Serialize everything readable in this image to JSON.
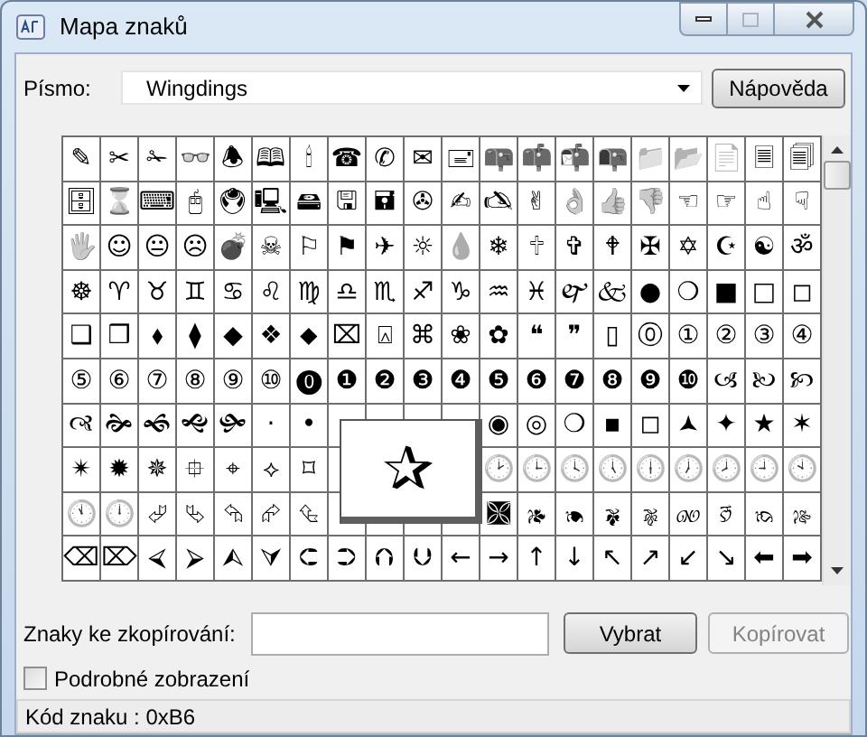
{
  "window": {
    "title": "Mapa znaků"
  },
  "font_label": "Písmo:",
  "font": {
    "value": "Wingdings"
  },
  "help_button": "Nápověda",
  "grid": {
    "rows": [
      [
        "✎",
        "✂",
        "✁",
        "👓",
        "🕭",
        "🕮",
        "🕯",
        "☎",
        "✆",
        "✉",
        "🖃",
        "📪",
        "📫",
        "📬",
        "📭",
        "📁",
        "📂",
        "📄",
        "🗏",
        "🗐"
      ],
      [
        "🗄",
        "⌛",
        "⌨",
        "🖰",
        "🖲",
        "🖳",
        "🖴",
        "🖫",
        "🖬",
        "✇",
        "✍",
        "🖎",
        "✌",
        "👌",
        "👍",
        "👎",
        "☜",
        "☞",
        "☝",
        "☟"
      ],
      [
        "🖐",
        "☺",
        "😐",
        "☹",
        "💣",
        "☠",
        "⚐",
        "⚑",
        "✈",
        "☼",
        "💧",
        "❄",
        "🕆",
        "✞",
        "🕈",
        "✠",
        "✡",
        "☪",
        "☯",
        "ॐ"
      ],
      [
        "☸",
        "♈",
        "♉",
        "♊",
        "♋",
        "♌",
        "♍",
        "♎",
        "♏",
        "♐",
        "♑",
        "♒",
        "♓",
        "🙰",
        "🙵",
        "●",
        "❍",
        "■",
        "□",
        "◻"
      ],
      [
        "❑",
        "❒",
        "⬧",
        "⧫",
        "◆",
        "❖",
        "⬥",
        "⌧",
        "⍓",
        "⌘",
        "❀",
        "✿",
        "❝",
        "❞",
        "▯",
        "⓪",
        "①",
        "②",
        "③",
        "④"
      ],
      [
        "⑤",
        "⑥",
        "⑦",
        "⑧",
        "⑨",
        "⑩",
        "⓿",
        "❶",
        "❷",
        "❸",
        "❹",
        "❺",
        "❻",
        "❼",
        "❽",
        "❾",
        "❿",
        "🙢",
        "🙠",
        "🙡"
      ],
      [
        "🙣",
        "🙞",
        "🙜",
        "🙝",
        "🙟",
        "·",
        "•",
        null,
        null,
        null,
        null,
        "◉",
        "◎",
        "❍",
        "▪",
        "◻",
        "🟂",
        "✦",
        "★",
        "✶"
      ],
      [
        "✴",
        "✹",
        "✵",
        "⯐",
        "⌖",
        "⟡",
        "⌑",
        null,
        null,
        null,
        null,
        "🕑",
        "🕒",
        "🕓",
        "🕔",
        "🕕",
        "🕖",
        "🕗",
        "🕘",
        "🕙"
      ],
      [
        "🕚",
        "🕛",
        "⮰",
        "⮱",
        "⮲",
        "⮳",
        "⮴",
        null,
        null,
        null,
        null,
        "🙫",
        "🙕",
        "🙔",
        "🙗",
        "🙖",
        "🙐",
        "🙑",
        "🙒",
        "🙓"
      ],
      [
        "⌫",
        "⌦",
        "⮘",
        "⮚",
        "⮙",
        "⮛",
        "⮈",
        "⮊",
        "⮉",
        "⮋",
        "←",
        "→",
        "↑",
        "↓",
        "↖",
        "↗",
        "↙",
        "↘",
        "⬅",
        "➡"
      ]
    ],
    "magnified": "✰"
  },
  "copy_label": "Znaky ke zkopírování:",
  "buttons": [
    {
      "label": "Vybrat",
      "disabled": false
    },
    {
      "label": "Kopírovat",
      "disabled": true
    }
  ],
  "advanced_view": {
    "label": "Podrobné zobrazení",
    "checked": false
  },
  "status_bar": "Kód znaku : 0xB6"
}
